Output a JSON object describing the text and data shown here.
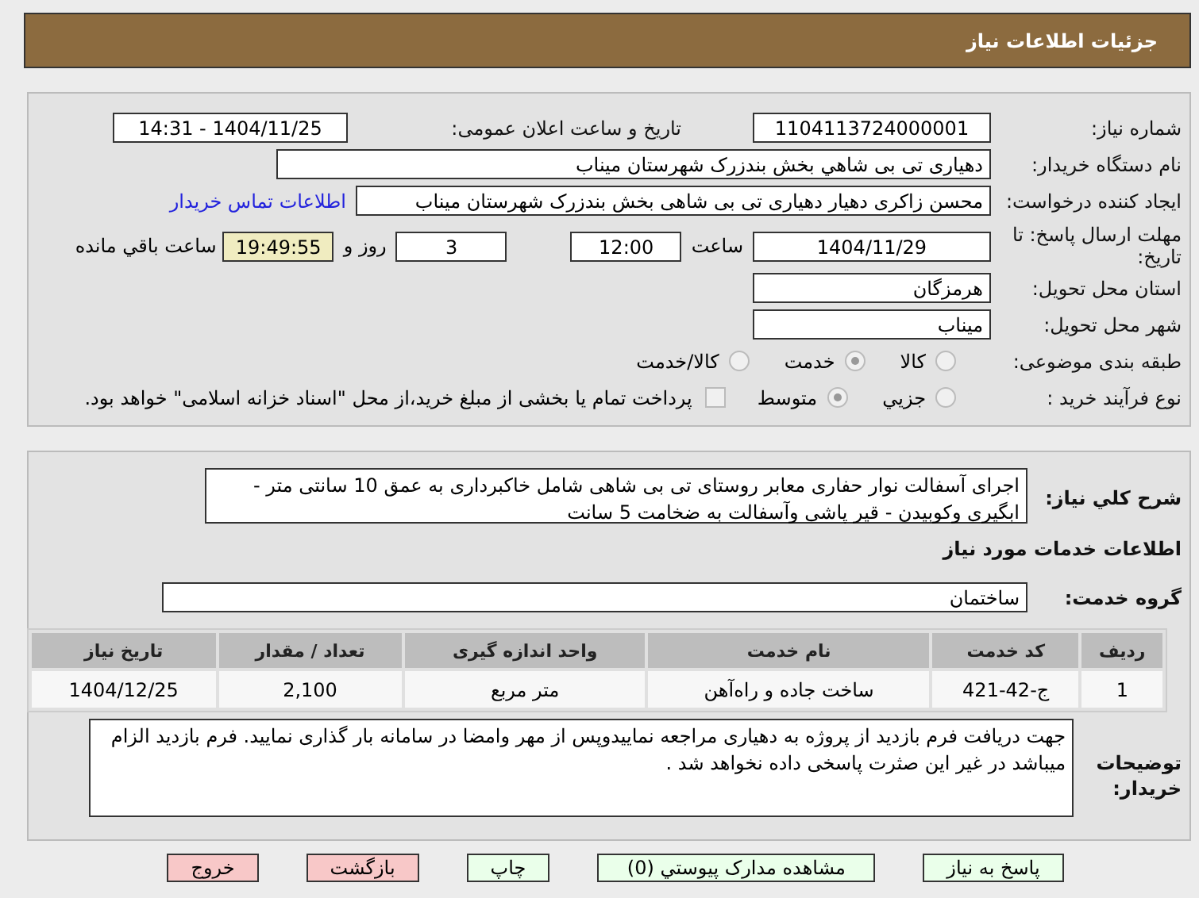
{
  "header": {
    "title": "جزئیات اطلاعات نیاز"
  },
  "info": {
    "need_number": {
      "label": "شماره نیاز:",
      "value": "1104113724000001"
    },
    "announce": {
      "label": "تاریخ و ساعت اعلان عمومی:",
      "value": "1404/11/25 - 14:31"
    },
    "buyer": {
      "label": "نام دستگاه خریدار:",
      "value": "دهیاری تی بی شاهي بخش بندزرک شهرستان میناب"
    },
    "creator": {
      "label": "ایجاد کننده درخواست:",
      "value": "محسن زاکری دهیار دهیاری تی بی شاهی بخش بندزرک شهرستان میناب",
      "link": "اطلاعات تماس خریدار"
    },
    "deadline": {
      "label": "مهلت ارسال پاسخ: تا تاریخ:",
      "date": "1404/11/29",
      "time_label": "ساعت",
      "time": "12:00",
      "days": "3",
      "days_label": "روز و",
      "remaining": "19:49:55",
      "remaining_label": "ساعت باقي مانده"
    },
    "province": {
      "label": "استان محل تحویل:",
      "value": "هرمزگان"
    },
    "city": {
      "label": "شهر محل تحویل:",
      "value": "میناب"
    },
    "category": {
      "label": "طبقه بندی موضوعی:",
      "options": [
        {
          "label": "کالا",
          "selected": false
        },
        {
          "label": "خدمت",
          "selected": true
        },
        {
          "label": "کالا/خدمت",
          "selected": false
        }
      ]
    },
    "process": {
      "label": "نوع فرآیند خرید :",
      "options": [
        {
          "label": "جزیي",
          "selected": false
        },
        {
          "label": "متوسط",
          "selected": true
        }
      ],
      "payment": {
        "checked": false,
        "label": "پرداخت تمام یا بخشی از مبلغ خرید،از محل \"اسناد خزانه اسلامی\" خواهد بود."
      }
    }
  },
  "details": {
    "description": {
      "label": "شرح کلي نیاز:",
      "value": "اجرای آسفالت نوار حفاری معابر روستای تی بی شاهی  شامل خاکبرداری به عمق 10 سانتی متر - ابگیری وکوبیدن - قیر پاشی وآسفالت به ضخامت 5 سانت"
    },
    "services_title": "اطلاعات خدمات مورد نیاز",
    "service_group": {
      "label": "گروه خدمت:",
      "value": "ساختمان"
    },
    "table": {
      "columns": [
        "ردیف",
        "کد خدمت",
        "نام خدمت",
        "واحد اندازه گیری",
        "تعداد / مقدار",
        "تاریخ نیاز"
      ],
      "rows": [
        [
          "1",
          "ج-42-421",
          "ساخت جاده و راه‌آهن",
          "متر مربع",
          "2,100",
          "1404/12/25"
        ]
      ]
    },
    "buyer_notes": {
      "label": "توضیحات خریدار:",
      "value": "جهت دریافت فرم بازدید از پروژه به دهیاری مراجعه نمایيدوپس از مهر وامضا در سامانه بار گذاری نمایید. فرم بازدید الزام میباشد در غیر این صثرت پاسخی داده نخواهد شد ."
    }
  },
  "buttons": [
    {
      "label": "پاسخ به نیاز",
      "kind": "green"
    },
    {
      "label": "مشاهده مدارک پیوستي (0)",
      "kind": "green"
    },
    {
      "label": "چاپ",
      "kind": "green"
    },
    {
      "label": "بازگشت",
      "kind": "red"
    },
    {
      "label": "خروج",
      "kind": "red"
    }
  ]
}
